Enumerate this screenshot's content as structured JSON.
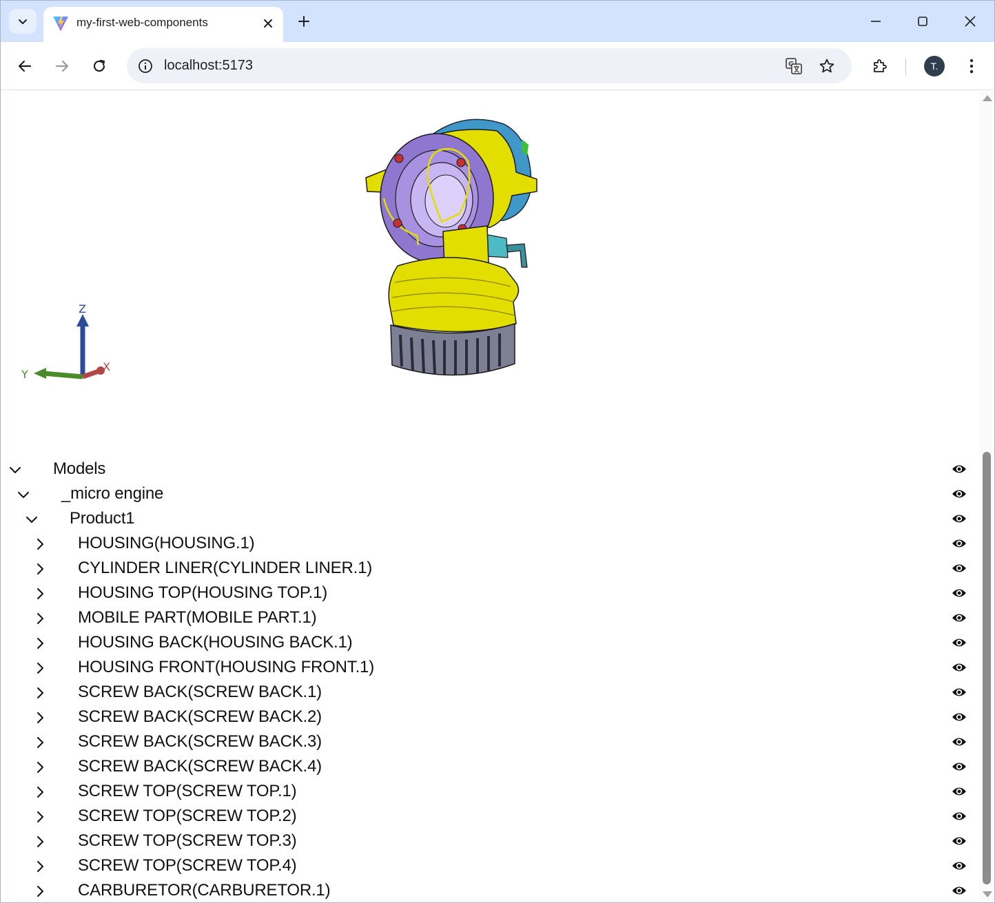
{
  "browser": {
    "tab_title": "my-first-web-components",
    "url": "localhost:5173",
    "avatar_initial": "T."
  },
  "viewer": {
    "axes": {
      "x": "X",
      "y": "Y",
      "z": "Z"
    },
    "colors": {
      "x_axis": "#b24545",
      "y_axis": "#4d8a2b",
      "z_axis": "#2c4c9a",
      "highlight": "#e2de00",
      "purple": "#8f77d0",
      "blue": "#3f98c8",
      "gray": "#7d7f94"
    }
  },
  "tree": {
    "rows": [
      {
        "label": "Models",
        "chevron": "down",
        "level": 0
      },
      {
        "label": "_micro engine",
        "chevron": "down",
        "level": 1
      },
      {
        "label": "Product1",
        "chevron": "down",
        "level": 2
      },
      {
        "label": "HOUSING(HOUSING.1)",
        "chevron": "right",
        "level": 3
      },
      {
        "label": "CYLINDER LINER(CYLINDER LINER.1)",
        "chevron": "right",
        "level": 3
      },
      {
        "label": "HOUSING TOP(HOUSING TOP.1)",
        "chevron": "right",
        "level": 3
      },
      {
        "label": "MOBILE PART(MOBILE PART.1)",
        "chevron": "right",
        "level": 3
      },
      {
        "label": "HOUSING BACK(HOUSING BACK.1)",
        "chevron": "right",
        "level": 3
      },
      {
        "label": "HOUSING FRONT(HOUSING FRONT.1)",
        "chevron": "right",
        "level": 3
      },
      {
        "label": "SCREW BACK(SCREW BACK.1)",
        "chevron": "right",
        "level": 3
      },
      {
        "label": "SCREW BACK(SCREW BACK.2)",
        "chevron": "right",
        "level": 3
      },
      {
        "label": "SCREW BACK(SCREW BACK.3)",
        "chevron": "right",
        "level": 3
      },
      {
        "label": "SCREW BACK(SCREW BACK.4)",
        "chevron": "right",
        "level": 3
      },
      {
        "label": "SCREW TOP(SCREW TOP.1)",
        "chevron": "right",
        "level": 3
      },
      {
        "label": "SCREW TOP(SCREW TOP.2)",
        "chevron": "right",
        "level": 3
      },
      {
        "label": "SCREW TOP(SCREW TOP.3)",
        "chevron": "right",
        "level": 3
      },
      {
        "label": "SCREW TOP(SCREW TOP.4)",
        "chevron": "right",
        "level": 3
      },
      {
        "label": "CARBURETOR(CARBURETOR.1)",
        "chevron": "right",
        "level": 3
      }
    ]
  }
}
